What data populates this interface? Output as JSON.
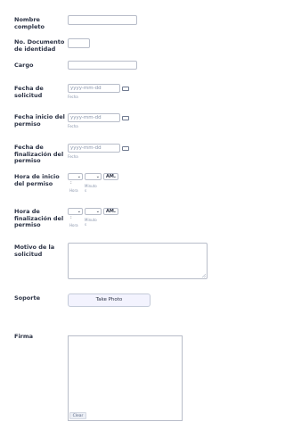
{
  "fields": {
    "nombre": {
      "label": "Nombre completo"
    },
    "documento": {
      "label": "No. Documento de identidad"
    },
    "cargo": {
      "label": "Cargo"
    },
    "fecha_solicitud": {
      "label": "Fecha de solicitud",
      "placeholder": "yyyy-mm-dd",
      "sublabel": "Fecha"
    },
    "fecha_inicio": {
      "label": "Fecha inicio del permiso",
      "placeholder": "yyyy-mm-dd",
      "sublabel": "Fecha"
    },
    "fecha_fin": {
      "label": "Fecha de finalización del permiso",
      "placeholder": "yyyy-mm-dd",
      "sublabel": "Fecha"
    },
    "hora_inicio": {
      "label": "Hora de inicio del permiso",
      "ampm": "AM",
      "hour_label": "Hora",
      "minute_label": "Minuto s",
      "colon": ":"
    },
    "hora_fin": {
      "label": "Hora de finalización del permiso",
      "ampm": "AM",
      "hour_label": "Hora",
      "minute_label": "Minuto s",
      "colon": ":"
    },
    "motivo": {
      "label": "Motivo de la solicitud"
    },
    "soporte": {
      "label": "Soporte",
      "button": "Take Photo"
    },
    "firma": {
      "label": "Firma",
      "clear": "Clear"
    }
  },
  "icons": {
    "calendar": "calendar-icon",
    "chevron": "chevron-down-icon"
  }
}
